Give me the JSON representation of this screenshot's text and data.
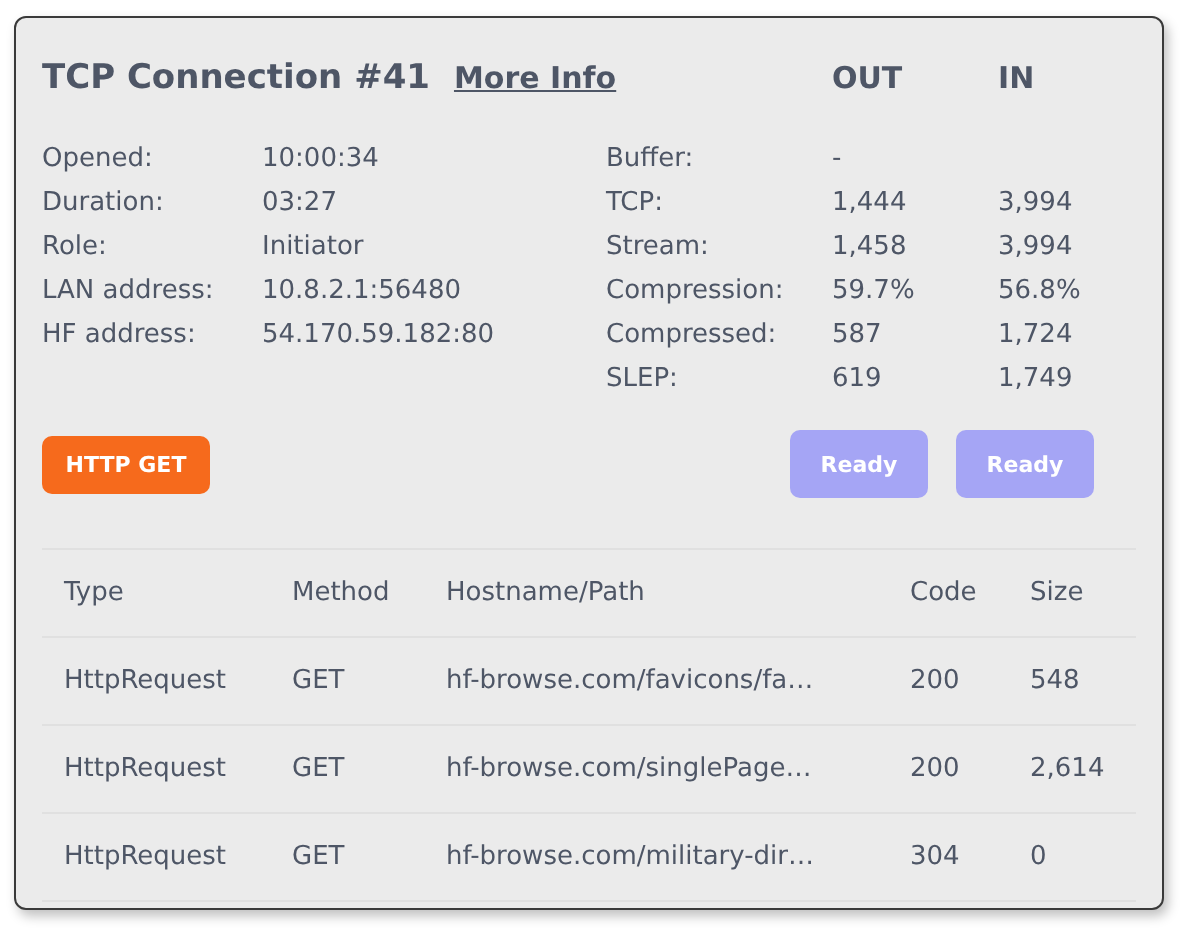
{
  "header": {
    "title": "TCP Connection #41",
    "link": "More Info",
    "columns": [
      "OUT",
      "IN"
    ]
  },
  "info": [
    {
      "label": "Opened:",
      "value": "10:00:34"
    },
    {
      "label": "Duration:",
      "value": "03:27"
    },
    {
      "label": "Role:",
      "value": "Initiator"
    },
    {
      "label": "LAN address:",
      "value": "10.8.2.1:56480"
    },
    {
      "label": "HF address:",
      "value": "54.170.59.182:80"
    }
  ],
  "stats": [
    {
      "label": "Buffer:",
      "out": "-"
    },
    {
      "label": "TCP:",
      "out": "1,444",
      "in": "3,994"
    },
    {
      "label": "Stream:",
      "out": "1,458",
      "in": "3,994"
    },
    {
      "label": "Compression:",
      "out": "59.7%",
      "in": "56.8%"
    },
    {
      "label": "Compressed:",
      "out": "587",
      "in": "1,724"
    },
    {
      "label": "SLEP:",
      "out": "619",
      "in": "1,749"
    }
  ],
  "protocol_badge": "HTTP GET",
  "status_buttons": [
    "Ready",
    "Ready"
  ],
  "table": {
    "columns": [
      "Type",
      "Method",
      "Hostname/Path",
      "Code",
      "Size"
    ],
    "rows": [
      [
        "HttpRequest",
        "GET",
        "hf-browse.com/favicons/fa…",
        "200",
        "548"
      ],
      [
        "HttpRequest",
        "GET",
        "hf-browse.com/singlePage…",
        "200",
        "2,614"
      ],
      [
        "HttpRequest",
        "GET",
        "hf-browse.com/military-dir…",
        "304",
        "0"
      ]
    ]
  }
}
